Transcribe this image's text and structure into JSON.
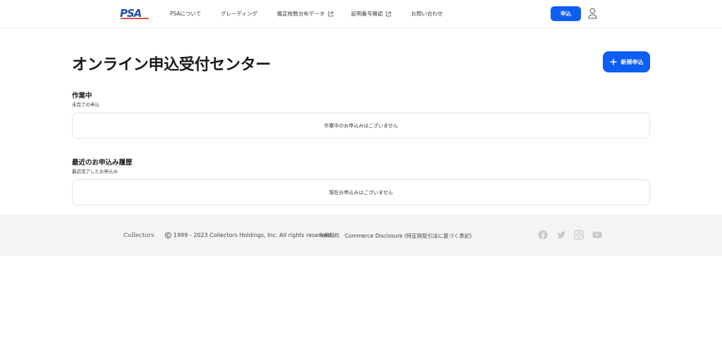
{
  "header": {
    "logo_text": "PSA",
    "nav": [
      {
        "label": "PSAについて",
        "external": false
      },
      {
        "label": "グレーディング",
        "external": false
      },
      {
        "label": "鑑定枚数分布データ",
        "external": true
      },
      {
        "label": "証明番号確認",
        "external": true
      },
      {
        "label": "お問い合わせ",
        "external": false
      }
    ],
    "apply_label": "申込"
  },
  "main": {
    "title": "オンライン申込受付センター",
    "new_button": "新規申込",
    "in_progress": {
      "title": "作業中",
      "subtitle": "未完了の申込",
      "empty_text": "作業中のお申込みはございません"
    },
    "history": {
      "title": "最近のお申込み履歴",
      "subtitle": "最近完了したお申込み",
      "empty_text": "現在お申込みはございません"
    }
  },
  "footer": {
    "brand": "Collectors",
    "copyright": "1999 - 2023 Collectors Holdings, Inc. All rights reserved.",
    "terms": "利用規約",
    "commerce": "Commerce Disclosure (特定商取引法に基づく表記)",
    "social": [
      "facebook-icon",
      "twitter-icon",
      "instagram-icon",
      "youtube-icon"
    ]
  },
  "colors": {
    "accent": "#0d5ef2",
    "logo_blue": "#1f4fa8",
    "logo_red": "#e2231a",
    "footer_bg": "#f4f4f4"
  }
}
